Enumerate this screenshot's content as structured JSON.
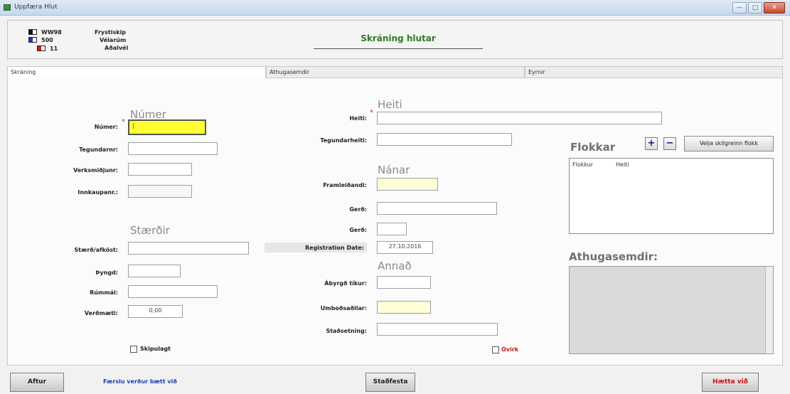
{
  "window": {
    "title": "Uppfæra Hlut",
    "btn_min": "—",
    "btn_max": "□",
    "btn_close": "✕"
  },
  "header": {
    "items": [
      {
        "label": "WW98",
        "icon": "black-white-square"
      },
      {
        "label": "500",
        "icon": "blue-white-square"
      },
      {
        "label": "11",
        "icon": "red-white-square"
      }
    ],
    "meta": [
      "Frystiskip",
      "Vélarúm",
      "Aðalvél"
    ],
    "title": "Skráning hlutar"
  },
  "tabs": [
    "Skráning",
    "Athugasemdir",
    "Eyrnir"
  ],
  "left": {
    "section_numer": "Númer",
    "numer_label": "Númer:",
    "numer_value": "|",
    "tegundarnr_label": "Tegundarnr:",
    "verksmidjunr_label": "Verksmiðjunr:",
    "innkaupanr_label": "Innkaupanr.:",
    "section_staerdir": "Stærðir",
    "staerd_label": "Stærð/afköst:",
    "thyngd_label": "Þyngd:",
    "rummal_label": "Rúmmál:",
    "verdmaeti_label": "Verðmæti:",
    "verdmaeti_value": "0,00",
    "skipulagt_label": "Skipulagt"
  },
  "middle": {
    "section_heiti": "Heiti",
    "heiti_label": "Heiti:",
    "tegundarheiti_label": "Tegundarheiti:",
    "section_nanar": "Nánar",
    "framleidandi_label": "Framleiðandi:",
    "gerd1_label": "Gerð:",
    "gerd2_label": "Gerð:",
    "regdate_label": "Registration Date:",
    "regdate_value": "27.10.2016",
    "section_annad": "Annað",
    "abyrgd_label": "Ábyrgð tíkur:",
    "umbodsadili_label": "Umboðsaðilar:",
    "stadsetning_label": "Staðsetning:",
    "ovirk_label": "Óvirk"
  },
  "right": {
    "flokkar_title": "Flokkar",
    "add_symbol": "+",
    "remove_symbol": "−",
    "choose_btn": "Velja skilgreinn flokk",
    "col_flokkur": "Flokkur",
    "col_heiti": "Heiti",
    "athugasemdir_title": "Athugasemdir:"
  },
  "footer": {
    "back_btn": "Aftur",
    "notice": "Færslu verður bætt við",
    "confirm_btn": "Staðfesta",
    "cancel_btn": "Hætta við"
  },
  "colors": {
    "accent_green": "#2e7a27",
    "required_red": "#d22222",
    "notice_blue": "#1d3fb8",
    "cancel_red": "#c0141a",
    "focus_yellow": "#ffff33"
  }
}
